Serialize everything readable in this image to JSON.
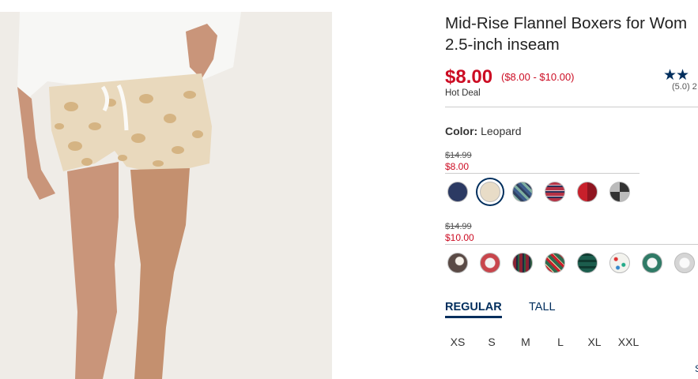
{
  "product": {
    "title_line1": "Mid-Rise Flannel Boxers for Wom",
    "title_line2": "2.5-inch inseam",
    "price": "$8.00",
    "price_range": "($8.00 - $10.00)",
    "deal_label": "Hot Deal",
    "stars": "★★",
    "rating_text": "(5.0) 2"
  },
  "color": {
    "label": "Color:",
    "value": "Leopard"
  },
  "price_groups": [
    {
      "was": "$14.99",
      "now": "$8.00",
      "swatches": [
        {
          "name": "navy-print",
          "color": "#2c3a63"
        },
        {
          "name": "leopard",
          "color": "#e8dcc7",
          "selected": true
        },
        {
          "name": "blue-plaid",
          "color": "#3d5d8c"
        },
        {
          "name": "red-navy-plaid",
          "color": "#b53245"
        },
        {
          "name": "red-buffalo-check",
          "color": "#c8202b"
        },
        {
          "name": "gray-black-check",
          "color": "#777777"
        }
      ]
    },
    {
      "was": "$14.99",
      "now": "$10.00",
      "swatches": [
        {
          "name": "dog-print",
          "color": "#5a4a45"
        },
        {
          "name": "santa-print",
          "color": "#c8454c"
        },
        {
          "name": "red-tartan",
          "color": "#8a2233"
        },
        {
          "name": "green-red-tartan",
          "color": "#2e6a4e"
        },
        {
          "name": "green-plaid",
          "color": "#1c5d4d"
        },
        {
          "name": "holiday-dots",
          "color": "#f3f3ee"
        },
        {
          "name": "teal-sheep",
          "color": "#2f7a66"
        },
        {
          "name": "polar-bear",
          "color": "#d5d5d5"
        }
      ]
    }
  ],
  "fit_tabs": {
    "regular": "REGULAR",
    "tall": "TALL"
  },
  "sizes": [
    "XS",
    "S",
    "M",
    "L",
    "XL",
    "XXL"
  ],
  "size_guide_fragment": "S",
  "colors": {
    "sale_red": "#cc0c23",
    "navy": "#002e5d"
  }
}
